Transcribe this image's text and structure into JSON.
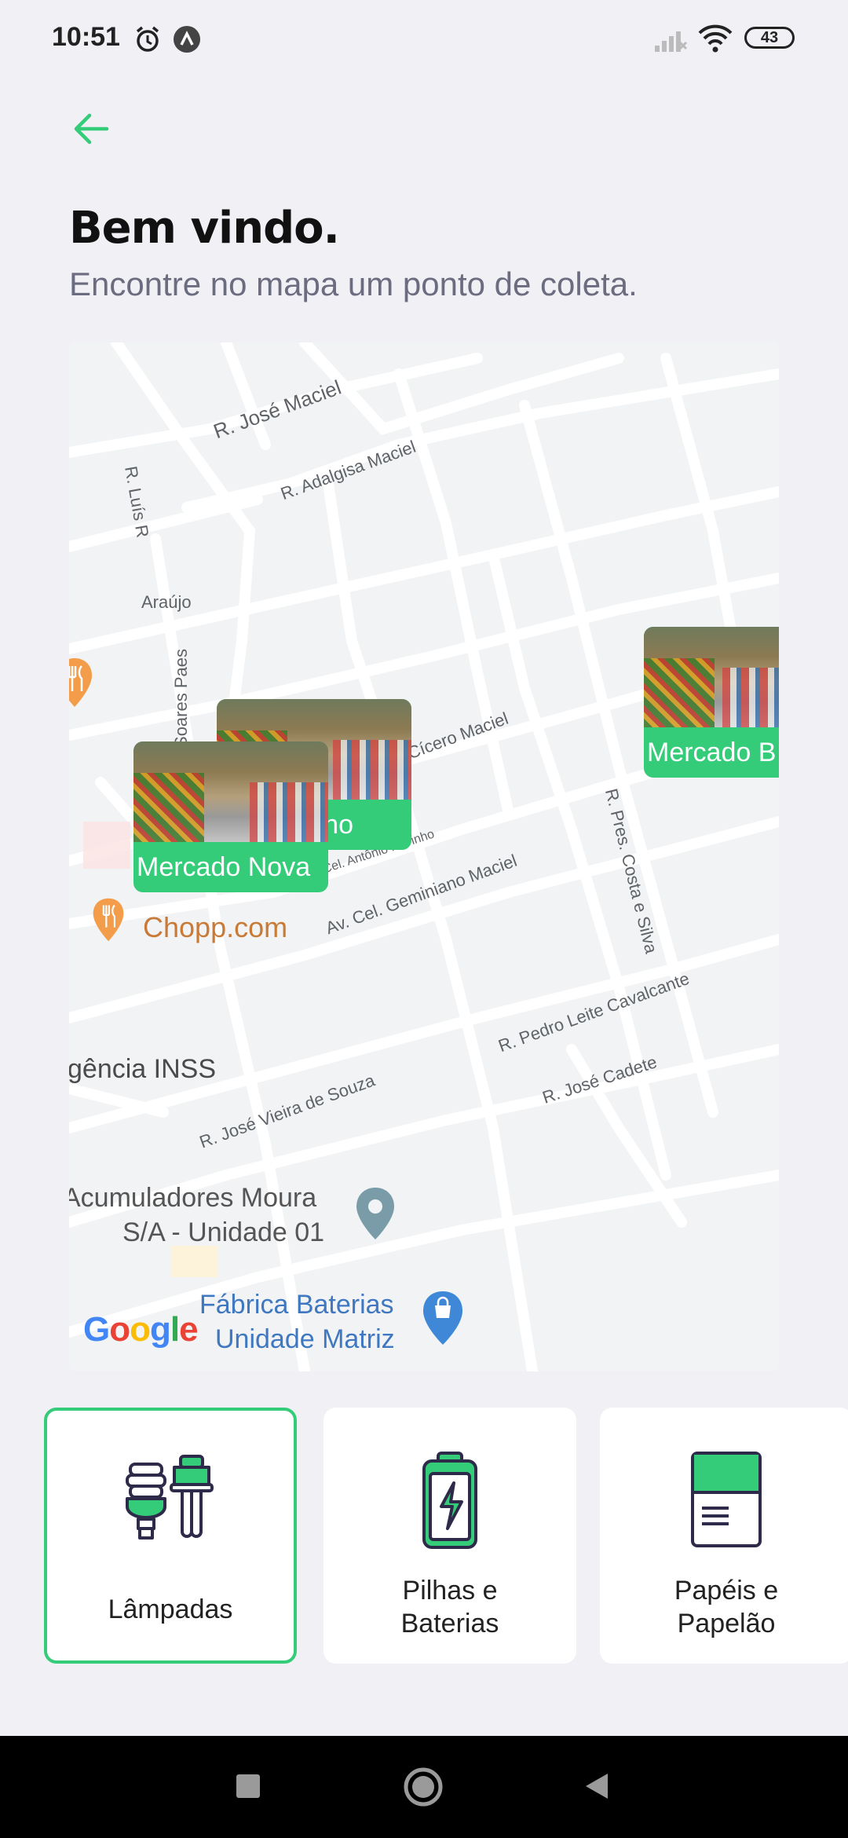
{
  "status_bar": {
    "time": "10:51",
    "battery": "43"
  },
  "header": {
    "title": "Bem vindo.",
    "subtitle": "Encontre no mapa um ponto de coleta."
  },
  "map": {
    "streets": [
      "R. José Maciel",
      "R. Adalgisa Maciel",
      "R. Luís R",
      "Araújo",
      "Soares Paes",
      "Cícero Maciel",
      "Cel. Antônio Marinho",
      "Av. Cel. Geminiano Maciel",
      "R. Pres. Costa e Silva",
      "R. Pedro Leite Cavalcante",
      "R. José Cadete",
      "R. José Vieira de Souza"
    ],
    "pois": [
      "Chopp.com",
      "gência INSS",
      "Acumuladores Moura",
      "S/A - Unidade 01",
      "Fábrica Baterias",
      "Unidade Matriz"
    ],
    "markers": [
      {
        "label": "Mercado Nova"
      },
      {
        "label": "no"
      },
      {
        "label": "Mercado B"
      }
    ],
    "attribution": "Google"
  },
  "categories": [
    {
      "line1": "Lâmpadas",
      "line2": "",
      "selected": true,
      "icon": "lightbulb-icon"
    },
    {
      "line1": "Pilhas e",
      "line2": "Baterias",
      "selected": false,
      "icon": "battery-icon"
    },
    {
      "line1": "Papéis e",
      "line2": "Papelão",
      "selected": false,
      "icon": "paper-icon"
    }
  ],
  "colors": {
    "accent": "#34cb79",
    "background": "#f0f0f5",
    "title": "#111111",
    "subtitle": "#6c6c80"
  }
}
